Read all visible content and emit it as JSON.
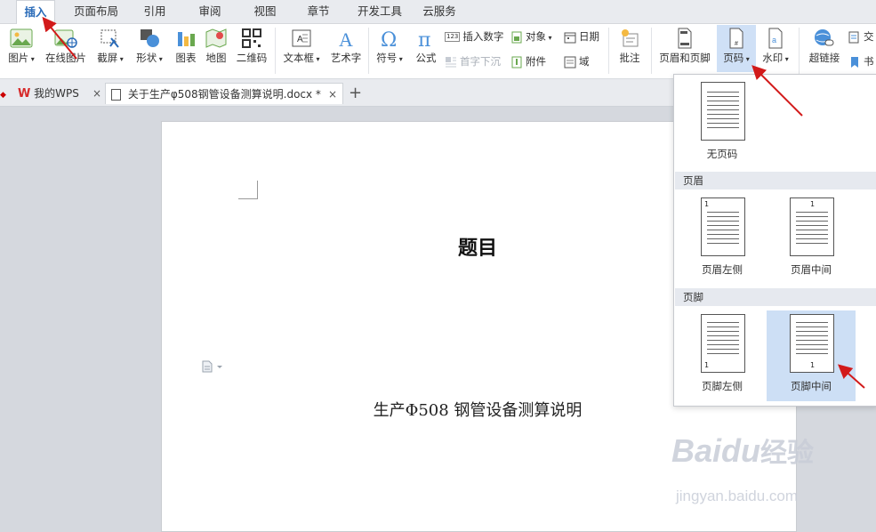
{
  "menu": {
    "tabs": [
      "插入",
      "页面布局",
      "引用",
      "审阅",
      "视图",
      "章节",
      "开发工具",
      "云服务"
    ],
    "active": "插入"
  },
  "ribbon": {
    "picture": "图片",
    "online_picture": "在线图片",
    "screenshot": "截屏",
    "shape": "形状",
    "chart": "图表",
    "map": "地图",
    "qrcode": "二维码",
    "textbox": "文本框",
    "wordart": "艺术字",
    "symbol": "符号",
    "formula": "公式",
    "insert_number": "插入数字",
    "drop_cap": "首字下沉",
    "object": "对象",
    "attachment": "附件",
    "date": "日期",
    "field": "域",
    "comment": "批注",
    "header_footer": "页眉和页脚",
    "page_number": "页码",
    "watermark": "水印",
    "hyperlink": "超链接",
    "cross_ref": "交",
    "bookmark": "书",
    "icon_123": "123"
  },
  "doc_tabs": {
    "home": "我的WPS",
    "current": "关于生产φ508钢管设备测算说明.docx *",
    "close": "×",
    "add": "+"
  },
  "document": {
    "title": "题目",
    "subtitle": "生产Φ508 钢管设备测算说明"
  },
  "page_number_menu": {
    "none": "无页码",
    "header_section": "页眉",
    "header_left": "页眉左侧",
    "header_center": "页眉中间",
    "footer_section": "页脚",
    "footer_left": "页脚左侧",
    "footer_center": "页脚中间",
    "thumb_number": "1"
  },
  "watermark": {
    "brand": "Bai",
    "brand_tail": "经验",
    "paw": "du",
    "url": "jingyan.baidu.com"
  },
  "colors": {
    "accent": "#2a6bb8",
    "annotation_arrow": "#d21a1a",
    "selected_bg": "#cddff5"
  }
}
